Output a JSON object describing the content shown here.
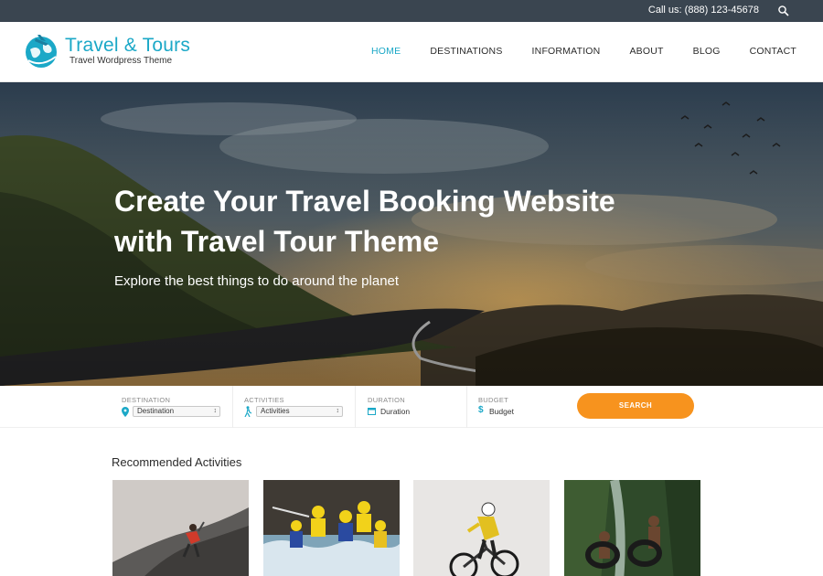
{
  "topbar": {
    "call_text": "Call us: (888) 123-45678",
    "search_icon": "search-icon"
  },
  "header": {
    "logo_title": "Travel & Tours",
    "logo_subtitle": "Travel Wordpress Theme",
    "brand_color": "#1ba8c7",
    "nav": [
      {
        "label": "HOME",
        "active": true
      },
      {
        "label": "DESTINATIONS",
        "active": false
      },
      {
        "label": "INFORMATION",
        "active": false
      },
      {
        "label": "ABOUT",
        "active": false
      },
      {
        "label": "BLOG",
        "active": false
      },
      {
        "label": "CONTACT",
        "active": false
      }
    ]
  },
  "hero": {
    "title_line1": "Create Your Travel Booking Website",
    "title_line2": "with Travel Tour Theme",
    "subtitle": "Explore the best things to do around the planet"
  },
  "search": {
    "destination": {
      "label": "DESTINATION",
      "value": "Destination",
      "icon": "map-pin-icon"
    },
    "activities": {
      "label": "ACTIVITIES",
      "value": "Activities",
      "icon": "hiker-icon"
    },
    "duration": {
      "label": "DURATION",
      "value": "Duration",
      "icon": "calendar-icon"
    },
    "budget": {
      "label": "BUDGET",
      "value": "Budget",
      "icon": "dollar-icon"
    },
    "button_label": "SEARCH",
    "button_color": "#f7931e"
  },
  "recommended": {
    "title": "Recommended Activities",
    "cards": [
      {
        "image": "climber-image"
      },
      {
        "image": "rafting-image"
      },
      {
        "image": "mountain-biker-image"
      },
      {
        "image": "tubing-waterfall-image"
      }
    ]
  }
}
